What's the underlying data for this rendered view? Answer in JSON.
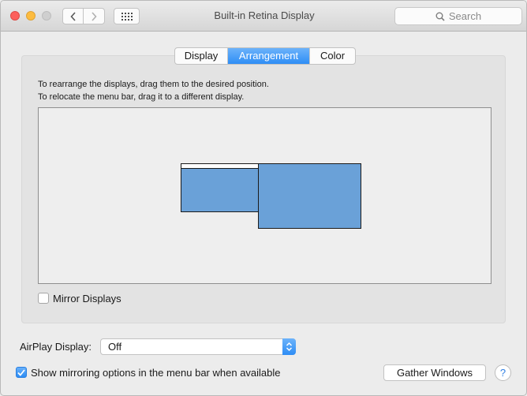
{
  "window": {
    "title": "Built-in Retina Display"
  },
  "search": {
    "placeholder": "Search"
  },
  "tabs": [
    {
      "label": "Display",
      "active": false
    },
    {
      "label": "Arrangement",
      "active": true
    },
    {
      "label": "Color",
      "active": false
    }
  ],
  "arrangement": {
    "instruction_1": "To rearrange the displays, drag them to the desired position.",
    "instruction_2": "To relocate the menu bar, drag it to a different display."
  },
  "mirror": {
    "label": "Mirror Displays",
    "checked": false
  },
  "airplay": {
    "label": "AirPlay Display:",
    "value": "Off"
  },
  "show_mirroring": {
    "label": "Show mirroring options in the menu bar when available",
    "checked": true
  },
  "gather": {
    "label": "Gather Windows"
  },
  "help": {
    "label": "?"
  },
  "colors": {
    "accent": "#2e8df5",
    "display_fill": "#6aa1d8"
  },
  "icons": [
    "close-icon",
    "minimize-icon",
    "zoom-icon",
    "chevron-left-icon",
    "chevron-right-icon",
    "grid-icon",
    "search-icon",
    "checkmark-icon",
    "popup-arrows-icon"
  ]
}
